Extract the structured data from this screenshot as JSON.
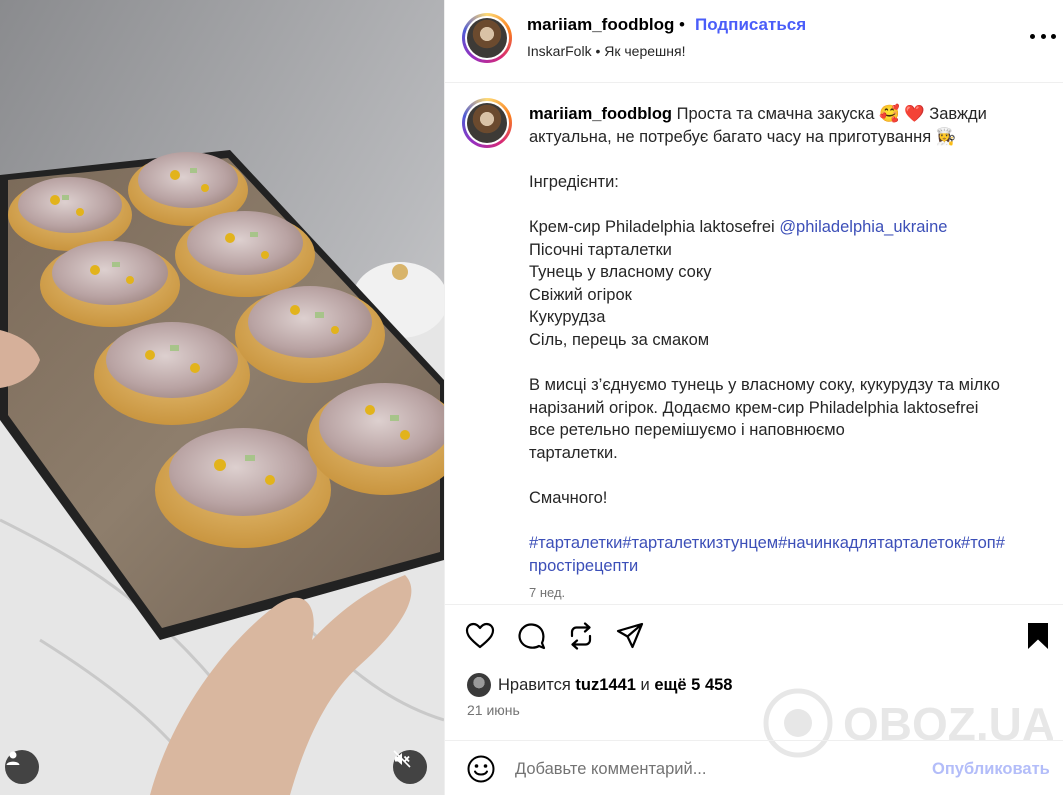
{
  "post": {
    "username": "mariiam_foodblog",
    "separator": "•",
    "follow_label": "Подписаться",
    "audio": "InskarFolk • Як черешня!",
    "caption": {
      "username": "mariiam_foodblog",
      "line1": " Проста та смачна закуска 🥰 ❤️  Завжди",
      "line2": "актуальна, не потребує багато часу на приготування 👩‍🍳",
      "ingredients_title": "Інгредієнти:",
      "ingredient_1": "Крем-сир Philadelphia laktosefrei ",
      "ingredient_1_mention": "@philadelphia_ukraine",
      "ingredient_2": "Пісочні тарталетки",
      "ingredient_3": "Тунець у власному соку",
      "ingredient_4": "Свіжий огірок",
      "ingredient_5": "Кукурудза",
      "ingredient_6": "Сіль, перець за смаком",
      "method_1": "В мисці з’єднуємо тунець у власному соку, кукурудзу та мілко",
      "method_2": "нарізаний огірок. Додаємо крем-сир Philadelphia laktosefrei",
      "method_3": "все ретельно перемішуємо і наповнюємо",
      "method_4": "тарталетки.",
      "closing": "Смачного!",
      "hashtags_1": "#тарталетки#тарталеткизтунцем#начинкадлятарталеток#топ#",
      "hashtags_2": "простірецепти"
    },
    "time_ago": "7 нед.",
    "likes": {
      "prefix": "Нравится ",
      "user": "tuz1441",
      "middle": " и ",
      "count": "ещё 5 458"
    },
    "date": "21 июнь",
    "comment": {
      "placeholder": "Добавьте комментарий...",
      "publish_label": "Опубликовать"
    },
    "watermark": "OBOZ.UA"
  },
  "icons": {
    "like": "heart-icon",
    "comment": "comment-icon",
    "repost": "repost-icon",
    "share": "share-icon",
    "save": "bookmark-icon",
    "more": "more-icon",
    "emoji": "emoji-icon",
    "user_tag": "user-tag-icon",
    "mute": "mute-icon"
  },
  "colors": {
    "accent": "#4a5df9",
    "link": "#3c4fb8",
    "publish_disabled": "#b3bdf9",
    "secondary_text": "#737373"
  }
}
